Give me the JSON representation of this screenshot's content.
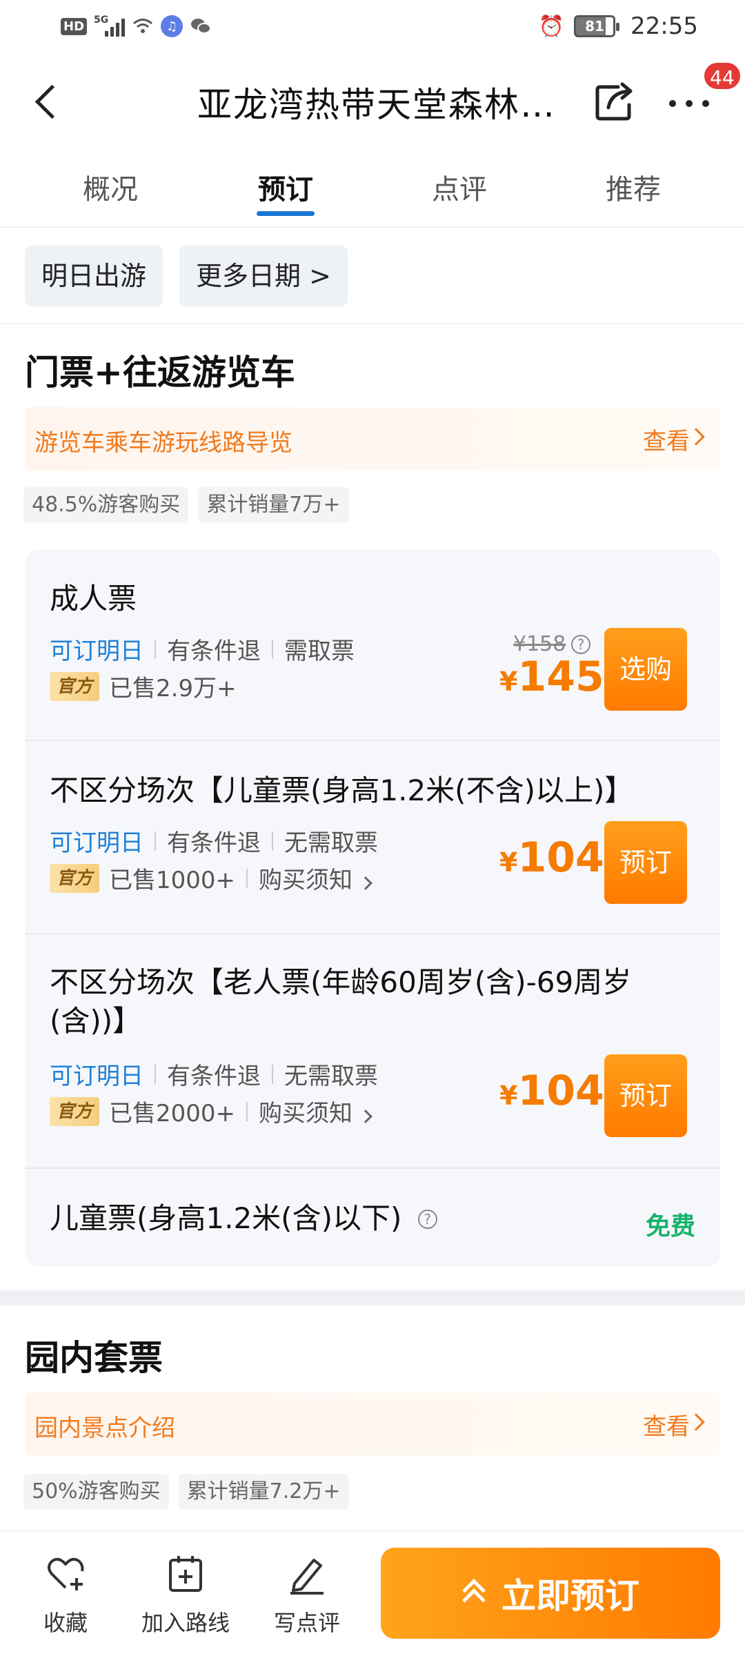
{
  "status_bar": {
    "battery": "81",
    "time": "22:55",
    "network": "5G"
  },
  "header": {
    "title": "亚龙湾热带天堂森林…",
    "badge_count": "44"
  },
  "tabs": [
    {
      "label": "概况"
    },
    {
      "label": "预订"
    },
    {
      "label": "点评"
    },
    {
      "label": "推荐"
    }
  ],
  "active_tab": "预订",
  "date_chips": {
    "tomorrow": "明日出游",
    "more_dates": "更多日期 >"
  },
  "section1": {
    "title": "门票+往返游览车",
    "guide_text": "游览车乘车游玩线路导览",
    "guide_link": "查看",
    "stats": [
      "48.5%游客购买",
      "累计销量7万+"
    ]
  },
  "tickets": [
    {
      "name": "成人票",
      "tag_avail": "可订明日",
      "tag_refund": "有条件退",
      "tag_pickup": "需取票",
      "official": "官方",
      "sold": "已售2.9万+",
      "orig_price": "¥158",
      "currency": "¥",
      "price": "145",
      "button": "选购"
    },
    {
      "name": "不区分场次【儿童票(身高1.2米(不含)以上)】",
      "tag_avail": "可订明日",
      "tag_refund": "有条件退",
      "tag_pickup": "无需取票",
      "official": "官方",
      "sold": "已售1000+",
      "notice": "购买须知",
      "currency": "¥",
      "price": "104",
      "button": "预订"
    },
    {
      "name": "不区分场次【老人票(年龄60周岁(含)-69周岁(含))】",
      "tag_avail": "可订明日",
      "tag_refund": "有条件退",
      "tag_pickup": "无需取票",
      "official": "官方",
      "sold": "已售2000+",
      "notice": "购买须知",
      "currency": "¥",
      "price": "104",
      "button": "预订"
    },
    {
      "name": "儿童票(身高1.2米(含)以下)",
      "free": "免费"
    }
  ],
  "section2": {
    "title": "园内套票",
    "guide_text": "园内景点介绍",
    "guide_link": "查看",
    "stats": [
      "50%游客购买",
      "累计销量7.2万+"
    ]
  },
  "bottom_bar": {
    "favorite": "收藏",
    "add_route": "加入路线",
    "write_review": "写点评",
    "book_now": "立即预订"
  },
  "colors": {
    "accent": "#ff7a00",
    "blue": "#1e7fd8",
    "free": "#16b36b"
  }
}
